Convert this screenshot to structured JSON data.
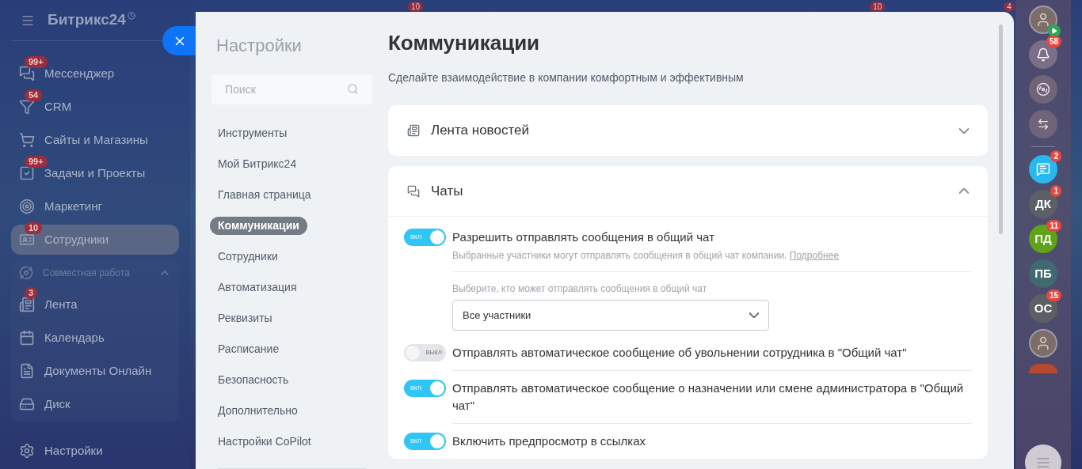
{
  "sidebar": {
    "logo": "Битрикс24",
    "items": [
      {
        "label": "Мессенджер",
        "badge": "99+",
        "selected": false
      },
      {
        "label": "CRM",
        "badge": "54",
        "selected": false
      },
      {
        "label": "Сайты и Магазины",
        "selected": false
      },
      {
        "label": "Задачи и Проекты",
        "badge": "99+",
        "selected": false
      },
      {
        "label": "Маркетинг",
        "selected": false
      },
      {
        "label": "Сотрудники",
        "badge": "10",
        "selected": true
      }
    ],
    "group": {
      "label": "Совместная работа",
      "expanded": true,
      "items": [
        {
          "label": "Лента",
          "badge": "3"
        },
        {
          "label": "Календарь"
        },
        {
          "label": "Документы Онлайн"
        },
        {
          "label": "Диск"
        }
      ]
    },
    "settings": "Настройки"
  },
  "header_badges": [
    "10",
    "10",
    "4"
  ],
  "panel": {
    "title": "Настройки",
    "search": {
      "placeholder": "Поиск"
    },
    "nav": [
      {
        "label": "Инструменты",
        "selected": false
      },
      {
        "label": "Мой Битрикс24",
        "selected": false
      },
      {
        "label": "Главная страница",
        "selected": false
      },
      {
        "label": "Коммуникации",
        "selected": true
      },
      {
        "label": "Сотрудники",
        "selected": false
      },
      {
        "label": "Автоматизация",
        "selected": false
      },
      {
        "label": "Реквизиты",
        "selected": false
      },
      {
        "label": "Расписание",
        "selected": false
      },
      {
        "label": "Безопасность",
        "selected": false
      },
      {
        "label": "Дополнительно",
        "selected": false
      },
      {
        "label": "Настройки CoPilot",
        "selected": false
      }
    ],
    "heading": "Коммуникации",
    "subtitle": "Сделайте взаимодействие в компании комфортным и эффективным",
    "sections": [
      {
        "title": "Лента новостей",
        "expanded": false
      },
      {
        "title": "Чаты",
        "expanded": true,
        "rows": [
          {
            "kind": "toggle",
            "on": true,
            "toggle_text": "вкл",
            "label": "Разрешить отправлять сообщения в общий чат",
            "description": "Выбранные участники могут отправлять сообщения в общий чат компании.",
            "link": "Подробнее"
          },
          {
            "kind": "select",
            "label": "Выберите, кто может отправлять сообщения в общий чат",
            "value": "Все участники"
          },
          {
            "kind": "toggle",
            "on": false,
            "toggle_text": "выкл",
            "label": "Отправлять автоматическое сообщение об увольнении сотрудника в \"Общий чат\""
          },
          {
            "kind": "toggle",
            "on": true,
            "toggle_text": "вкл",
            "label": "Отправлять автоматическое сообщение о назначении или смене администратора в \"Общий чат\""
          },
          {
            "kind": "toggle",
            "on": true,
            "toggle_text": "вкл",
            "label": "Включить предпросмотр в ссылках"
          }
        ]
      }
    ]
  },
  "rail": [
    {
      "kind": "user-photo",
      "status": true
    },
    {
      "kind": "bell",
      "badge": "58"
    },
    {
      "kind": "copilot"
    },
    {
      "kind": "exchange"
    },
    {
      "kind": "divider"
    },
    {
      "kind": "chat",
      "badge": "2"
    },
    {
      "kind": "initials",
      "text": "ДК",
      "color": "#5c6066",
      "badge": "1"
    },
    {
      "kind": "initials",
      "text": "ПД",
      "color": "#5fa318",
      "badge": "11"
    },
    {
      "kind": "initials",
      "text": "ПБ",
      "color": "#3f6a70"
    },
    {
      "kind": "initials",
      "text": "ОС",
      "color": "#5c6066",
      "badge": "15"
    },
    {
      "kind": "user-photo",
      "status": false
    },
    {
      "kind": "partial",
      "color": "#b5492f"
    }
  ]
}
